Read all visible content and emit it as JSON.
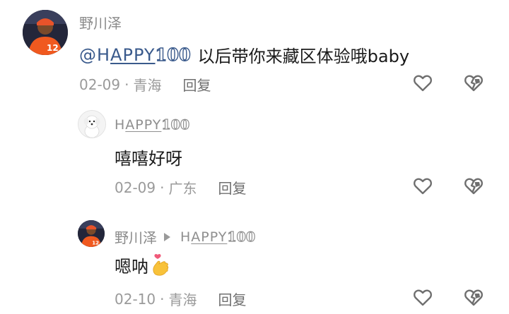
{
  "comments": [
    {
      "username": "野川泽",
      "text": "以后带你来藏区体验哦baby",
      "mention": {
        "prefix": "@H",
        "underlined": "APPY",
        "number": "100"
      },
      "date": "02-09",
      "separator": "·",
      "location": "青海",
      "reply_label": "回复",
      "avatar_icon": "basketball-player-avatar"
    },
    {
      "username_parts": {
        "prefix": "H",
        "underlined": "APPY",
        "number": "100"
      },
      "text": "嘻嘻好呀",
      "date": "02-09",
      "separator": "·",
      "location": "广东",
      "reply_label": "回复",
      "avatar_icon": "white-dog-avatar"
    },
    {
      "username": "野川泽",
      "reply_to_parts": {
        "prefix": "H",
        "underlined": "APPY",
        "number": "100"
      },
      "text": "嗯呐",
      "date": "02-10",
      "separator": "·",
      "location": "青海",
      "reply_label": "回复",
      "avatar_icon": "basketball-player-avatar",
      "emoji": "finger-heart-emoji"
    }
  ],
  "colors": {
    "username": "#8a8a8a",
    "mention": "#3a5a8c",
    "meta": "#9a9a9a",
    "text": "#1a1a1a",
    "icon": "#6f6f6f"
  },
  "icons": {
    "like": "heart-outline-icon",
    "dislike": "broken-heart-icon"
  }
}
